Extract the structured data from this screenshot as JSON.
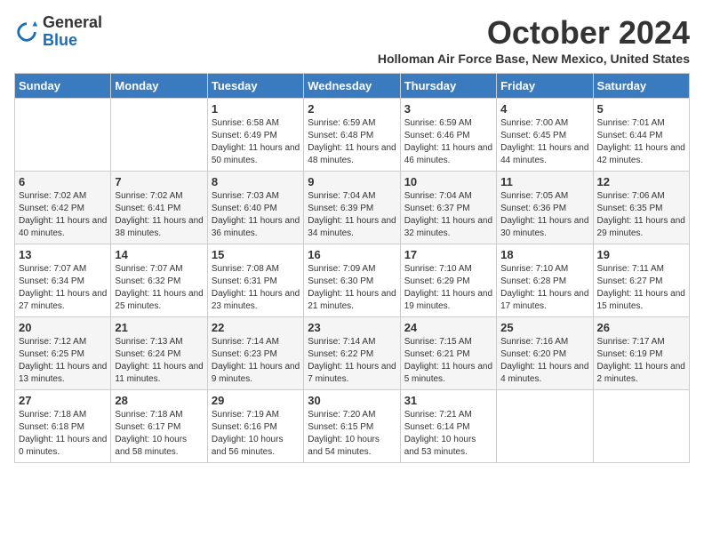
{
  "header": {
    "logo_line1": "General",
    "logo_line2": "Blue",
    "month_title": "October 2024",
    "subtitle": "Holloman Air Force Base, New Mexico, United States"
  },
  "weekdays": [
    "Sunday",
    "Monday",
    "Tuesday",
    "Wednesday",
    "Thursday",
    "Friday",
    "Saturday"
  ],
  "weeks": [
    [
      {
        "day": "",
        "info": ""
      },
      {
        "day": "",
        "info": ""
      },
      {
        "day": "1",
        "info": "Sunrise: 6:58 AM\nSunset: 6:49 PM\nDaylight: 11 hours and 50 minutes."
      },
      {
        "day": "2",
        "info": "Sunrise: 6:59 AM\nSunset: 6:48 PM\nDaylight: 11 hours and 48 minutes."
      },
      {
        "day": "3",
        "info": "Sunrise: 6:59 AM\nSunset: 6:46 PM\nDaylight: 11 hours and 46 minutes."
      },
      {
        "day": "4",
        "info": "Sunrise: 7:00 AM\nSunset: 6:45 PM\nDaylight: 11 hours and 44 minutes."
      },
      {
        "day": "5",
        "info": "Sunrise: 7:01 AM\nSunset: 6:44 PM\nDaylight: 11 hours and 42 minutes."
      }
    ],
    [
      {
        "day": "6",
        "info": "Sunrise: 7:02 AM\nSunset: 6:42 PM\nDaylight: 11 hours and 40 minutes."
      },
      {
        "day": "7",
        "info": "Sunrise: 7:02 AM\nSunset: 6:41 PM\nDaylight: 11 hours and 38 minutes."
      },
      {
        "day": "8",
        "info": "Sunrise: 7:03 AM\nSunset: 6:40 PM\nDaylight: 11 hours and 36 minutes."
      },
      {
        "day": "9",
        "info": "Sunrise: 7:04 AM\nSunset: 6:39 PM\nDaylight: 11 hours and 34 minutes."
      },
      {
        "day": "10",
        "info": "Sunrise: 7:04 AM\nSunset: 6:37 PM\nDaylight: 11 hours and 32 minutes."
      },
      {
        "day": "11",
        "info": "Sunrise: 7:05 AM\nSunset: 6:36 PM\nDaylight: 11 hours and 30 minutes."
      },
      {
        "day": "12",
        "info": "Sunrise: 7:06 AM\nSunset: 6:35 PM\nDaylight: 11 hours and 29 minutes."
      }
    ],
    [
      {
        "day": "13",
        "info": "Sunrise: 7:07 AM\nSunset: 6:34 PM\nDaylight: 11 hours and 27 minutes."
      },
      {
        "day": "14",
        "info": "Sunrise: 7:07 AM\nSunset: 6:32 PM\nDaylight: 11 hours and 25 minutes."
      },
      {
        "day": "15",
        "info": "Sunrise: 7:08 AM\nSunset: 6:31 PM\nDaylight: 11 hours and 23 minutes."
      },
      {
        "day": "16",
        "info": "Sunrise: 7:09 AM\nSunset: 6:30 PM\nDaylight: 11 hours and 21 minutes."
      },
      {
        "day": "17",
        "info": "Sunrise: 7:10 AM\nSunset: 6:29 PM\nDaylight: 11 hours and 19 minutes."
      },
      {
        "day": "18",
        "info": "Sunrise: 7:10 AM\nSunset: 6:28 PM\nDaylight: 11 hours and 17 minutes."
      },
      {
        "day": "19",
        "info": "Sunrise: 7:11 AM\nSunset: 6:27 PM\nDaylight: 11 hours and 15 minutes."
      }
    ],
    [
      {
        "day": "20",
        "info": "Sunrise: 7:12 AM\nSunset: 6:25 PM\nDaylight: 11 hours and 13 minutes."
      },
      {
        "day": "21",
        "info": "Sunrise: 7:13 AM\nSunset: 6:24 PM\nDaylight: 11 hours and 11 minutes."
      },
      {
        "day": "22",
        "info": "Sunrise: 7:14 AM\nSunset: 6:23 PM\nDaylight: 11 hours and 9 minutes."
      },
      {
        "day": "23",
        "info": "Sunrise: 7:14 AM\nSunset: 6:22 PM\nDaylight: 11 hours and 7 minutes."
      },
      {
        "day": "24",
        "info": "Sunrise: 7:15 AM\nSunset: 6:21 PM\nDaylight: 11 hours and 5 minutes."
      },
      {
        "day": "25",
        "info": "Sunrise: 7:16 AM\nSunset: 6:20 PM\nDaylight: 11 hours and 4 minutes."
      },
      {
        "day": "26",
        "info": "Sunrise: 7:17 AM\nSunset: 6:19 PM\nDaylight: 11 hours and 2 minutes."
      }
    ],
    [
      {
        "day": "27",
        "info": "Sunrise: 7:18 AM\nSunset: 6:18 PM\nDaylight: 11 hours and 0 minutes."
      },
      {
        "day": "28",
        "info": "Sunrise: 7:18 AM\nSunset: 6:17 PM\nDaylight: 10 hours and 58 minutes."
      },
      {
        "day": "29",
        "info": "Sunrise: 7:19 AM\nSunset: 6:16 PM\nDaylight: 10 hours and 56 minutes."
      },
      {
        "day": "30",
        "info": "Sunrise: 7:20 AM\nSunset: 6:15 PM\nDaylight: 10 hours and 54 minutes."
      },
      {
        "day": "31",
        "info": "Sunrise: 7:21 AM\nSunset: 6:14 PM\nDaylight: 10 hours and 53 minutes."
      },
      {
        "day": "",
        "info": ""
      },
      {
        "day": "",
        "info": ""
      }
    ]
  ]
}
